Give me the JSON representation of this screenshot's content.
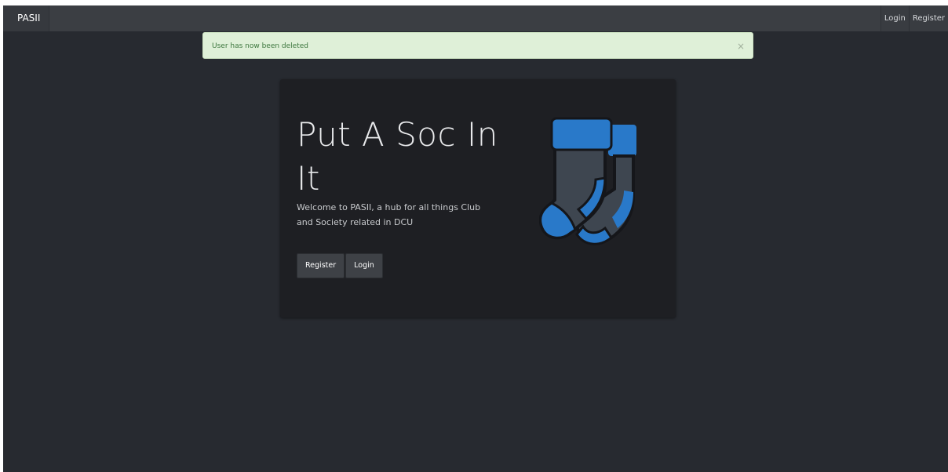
{
  "navbar": {
    "brand": "PASII",
    "links": [
      "Login",
      "Register"
    ]
  },
  "alert": {
    "message": "User has now been deleted",
    "close_symbol": "×"
  },
  "hero": {
    "title": "Put A Soc In It",
    "subtitle": "Welcome to PASII, a hub for all things Club and Society related in DCU",
    "buttons": [
      "Register",
      "Login"
    ],
    "image_icon": "socks-icon"
  },
  "colors": {
    "page_bg": "#272a30",
    "navbar_bg": "#3b3e43",
    "alert_bg": "#dff0d8",
    "alert_text": "#3c763d",
    "panel_bg": "#1e1f23",
    "sock_blue": "#2979c9",
    "sock_grey": "#3e4650"
  }
}
